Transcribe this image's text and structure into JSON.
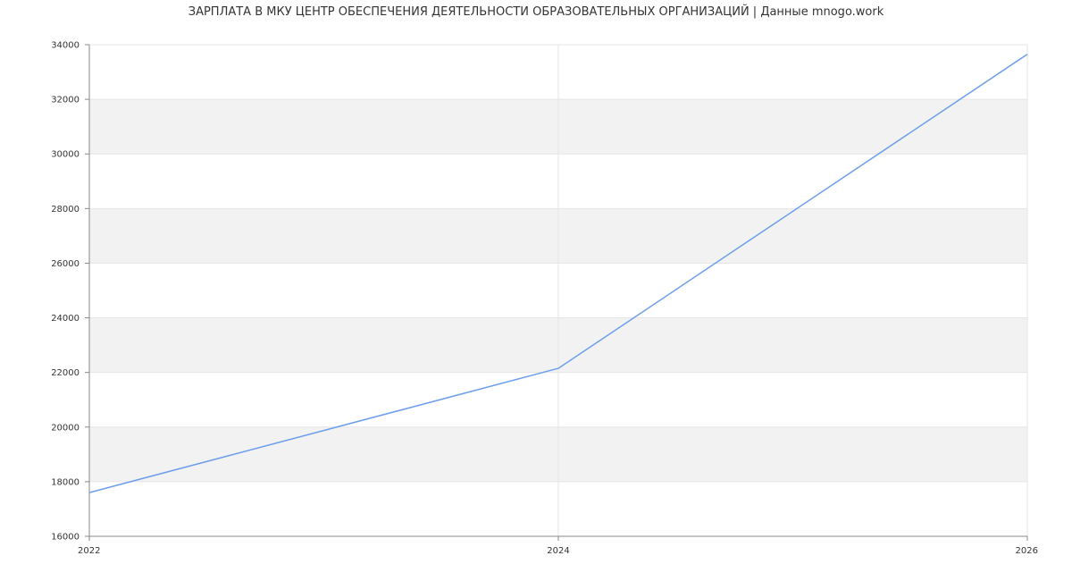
{
  "page": {
    "title": "ЗАРПЛАТА В МКУ ЦЕНТР ОБЕСПЕЧЕНИЯ ДЕЯТЕЛЬНОСТИ ОБРАЗОВАТЕЛЬНЫХ ОРГАНИЗАЦИЙ | Данные mnogo.work"
  },
  "chart_data": {
    "type": "line",
    "title": "ЗАРПЛАТА В МКУ ЦЕНТР ОБЕСПЕЧЕНИЯ ДЕЯТЕЛЬНОСТИ ОБРАЗОВАТЕЛЬНЫХ ОРГАНИЗАЦИЙ | Данные mnogo.work",
    "xlabel": "",
    "ylabel": "",
    "x": [
      2022,
      2024,
      2026
    ],
    "series": [
      {
        "values": [
          17600,
          22150,
          33650
        ],
        "color": "#6d9eeb"
      }
    ],
    "xlim": [
      2022,
      2026
    ],
    "ylim": [
      16000,
      34000
    ],
    "xticks": [
      "2022",
      "2024",
      "2026"
    ],
    "yticks": [
      "16000",
      "18000",
      "20000",
      "22000",
      "24000",
      "26000",
      "28000",
      "30000",
      "32000",
      "34000"
    ],
    "grid": true,
    "alternating_bands": true,
    "colors": {
      "band": "#f2f2f2",
      "grid": "#e6e6e6",
      "axis": "#888888",
      "line": "#6d9eeb"
    }
  }
}
